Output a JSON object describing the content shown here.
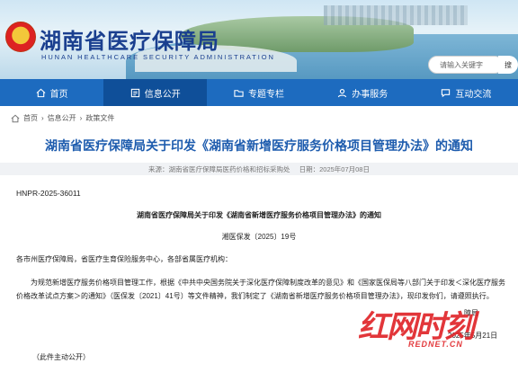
{
  "header": {
    "title": "湖南省医疗保障局",
    "subtitle": "HUNAN HEALTHCARE SECURITY ADMINISTRATION",
    "search_placeholder": "请输入关键字",
    "search_button": "搜"
  },
  "nav": {
    "items": [
      {
        "label": "首页",
        "icon": "home-icon"
      },
      {
        "label": "信息公开",
        "icon": "info-icon"
      },
      {
        "label": "专题专栏",
        "icon": "folder-icon"
      },
      {
        "label": "办事服务",
        "icon": "user-icon"
      },
      {
        "label": "互动交流",
        "icon": "chat-icon"
      }
    ],
    "active_index": 1
  },
  "breadcrumb": {
    "items": [
      "首页",
      "信息公开",
      "政策文件"
    ],
    "separator": "›"
  },
  "article": {
    "title": "湖南省医疗保障局关于印发《湖南省新增医疗服务价格项目管理办法》的通知",
    "source_label": "来源：湖南省医疗保障局医药价格和招标采购处",
    "date_label": "日期：2025年07月08日",
    "doc_number": "HNPR-2025-36011",
    "doc_title": "湖南省医疗保障局关于印发《湖南省新增医疗服务价格项目管理办法》的通知",
    "doc_ref": "湘医保发〔2025〕19号",
    "recipients": "各市州医疗保障局，省医疗生育保险服务中心，各部省属医疗机构：",
    "paragraph": "为规范新增医疗服务价格项目管理工作，根据《中共中央国务院关于深化医疗保障制度改革的意见》和《国家医保局等八部门关于印发＜深化医疗服务价格改革试点方案＞的通知》（医保发〔2021〕41号）等文件精神，我们制定了《湖南省新增医疗服务价格项目管理办法》，现印发你们，请遵照执行。",
    "sign_org": "障局",
    "sign_date": "2025年5月21日",
    "footnote": "（此件主动公开）"
  },
  "watermark": {
    "main": "红网时刻",
    "sub": "REDNET.CN"
  },
  "colors": {
    "nav_bg": "#1d6bbf",
    "nav_active": "#0f4f99",
    "title_blue": "#1e5cae",
    "watermark_red": "#e0262a"
  }
}
